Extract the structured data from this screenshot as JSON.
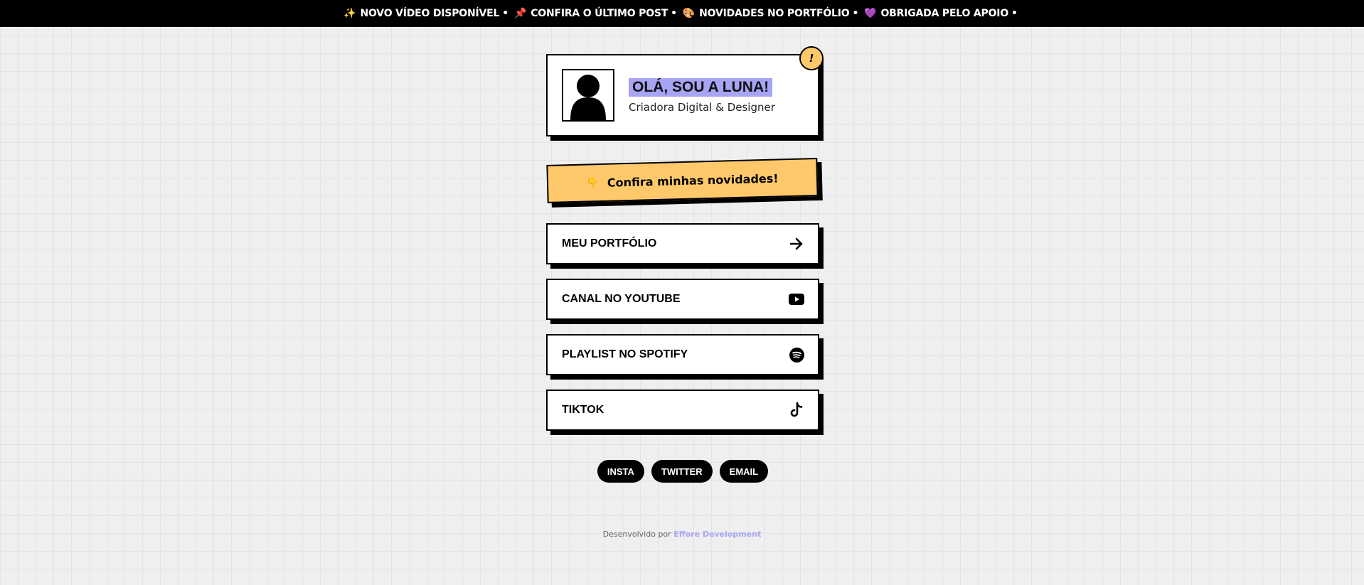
{
  "ticker": {
    "items": [
      {
        "emoji": "✨",
        "text": "NOVO VÍDEO DISPONÍVEL"
      },
      {
        "emoji": "📌",
        "text": "CONFIRA O ÚLTIMO POST"
      },
      {
        "emoji": "🎨",
        "text": "NOVIDADES NO PORTFÓLIO"
      },
      {
        "emoji": "💜",
        "text": "OBRIGADA PELO APOIO"
      }
    ],
    "separator": "•"
  },
  "profile": {
    "badge": "!",
    "name": "OLÁ, SOU A LUNA!",
    "subtitle": "Criadora Digital & Designer",
    "avatar_icon": "user-silhouette-icon"
  },
  "banner": {
    "emoji": "👇",
    "text": "Confira minhas novidades!"
  },
  "links": [
    {
      "label": "MEU PORTFÓLIO",
      "icon": "arrow-right-icon"
    },
    {
      "label": "CANAL NO YOUTUBE",
      "icon": "youtube-icon"
    },
    {
      "label": "PLAYLIST NO SPOTIFY",
      "icon": "spotify-icon"
    },
    {
      "label": "TIKTOK",
      "icon": "tiktok-icon"
    }
  ],
  "social": [
    "INSTA",
    "TWITTER",
    "EMAIL"
  ],
  "footer": {
    "prefix": "Desenvolvido por",
    "developer": "Effore Development"
  },
  "colors": {
    "accent_yellow": "#ffc96b",
    "accent_purple": "#a8a4f4",
    "background": "#efefef",
    "ink": "#000000"
  }
}
